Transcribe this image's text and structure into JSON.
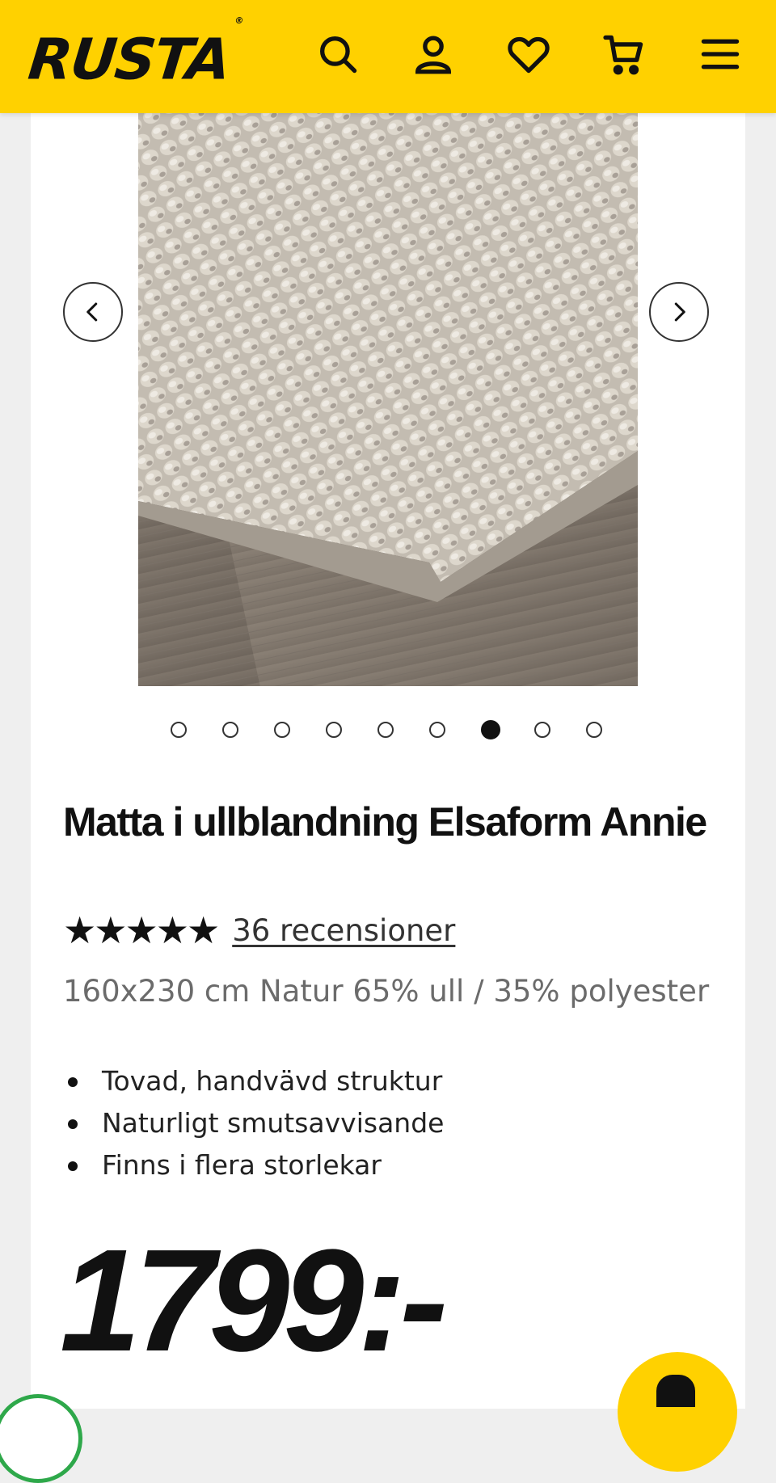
{
  "header": {
    "logo": "RUSTA",
    "logo_mark": "®",
    "icons": [
      "search-icon",
      "account-icon",
      "heart-icon",
      "cart-icon",
      "menu-icon"
    ],
    "background": "#ffd100"
  },
  "gallery": {
    "image_count": 9,
    "active_index": 6,
    "prev_icon": "chevron-left-icon",
    "next_icon": "chevron-right-icon"
  },
  "product": {
    "title": "Matta i ullblandning Elsaform Annie",
    "stars": "★★★★★",
    "rating": 5,
    "reviews_label": "36 recensioner",
    "subtitle": "160x230 cm Natur 65% ull / 35% polyester",
    "features": [
      "Tovad, handvävd struktur",
      "Naturligt smutsavvisande",
      "Finns i flera storlekar"
    ],
    "price": "1799:-"
  },
  "colors": {
    "accent": "#ffd100",
    "text": "#111111",
    "muted": "#6b6b6b"
  }
}
